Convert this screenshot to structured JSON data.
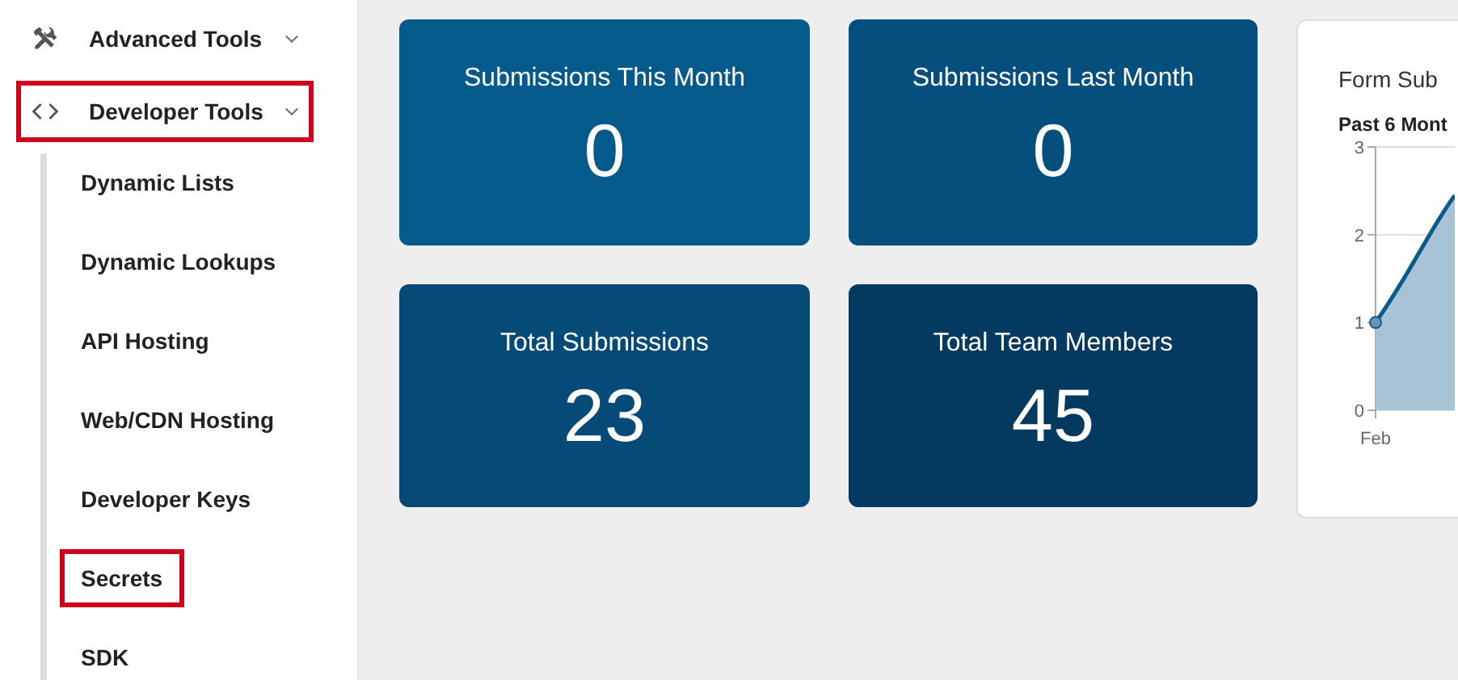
{
  "sidebar": {
    "items": [
      {
        "label": "Advanced Tools",
        "highlighted": false
      },
      {
        "label": "Developer Tools",
        "highlighted": true,
        "children": [
          {
            "label": "Dynamic Lists",
            "highlighted": false
          },
          {
            "label": "Dynamic Lookups",
            "highlighted": false
          },
          {
            "label": "API Hosting",
            "highlighted": false
          },
          {
            "label": "Web/CDN Hosting",
            "highlighted": false
          },
          {
            "label": "Developer Keys",
            "highlighted": false
          },
          {
            "label": "Secrets",
            "highlighted": true
          },
          {
            "label": "SDK",
            "highlighted": false
          }
        ]
      }
    ]
  },
  "stats": [
    {
      "title": "Submissions This Month",
      "value": "0",
      "color": "#055a8c"
    },
    {
      "title": "Submissions Last Month",
      "value": "0",
      "color": "#054f7f"
    },
    {
      "title": "Total Submissions",
      "value": "23",
      "color": "#064a78"
    },
    {
      "title": "Total Team Members",
      "value": "45",
      "color": "#043a5f"
    }
  ],
  "chart_card": {
    "title": "Form Sub",
    "subtitle": "Past 6 Mont",
    "y_axis_labels": [
      "3",
      "2",
      "1",
      "0"
    ],
    "x_axis_labels": [
      "Feb"
    ]
  }
}
